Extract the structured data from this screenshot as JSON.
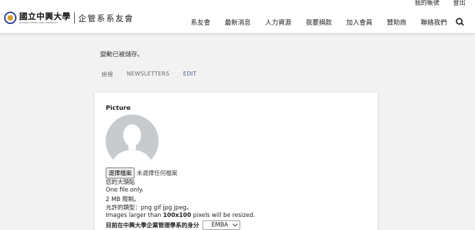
{
  "header": {
    "top_links": [
      "我的帳號",
      "登出"
    ],
    "logo": {
      "university": "國立中興大學",
      "university_en": "NATIONAL CHUNG HSING UNIVERSITY",
      "department": "企管系系友會"
    },
    "nav": [
      "系友會",
      "最新消息",
      "人力資源",
      "我要捐款",
      "加入會員",
      "贊助商",
      "聯絡我們"
    ],
    "search_icon": "search-icon"
  },
  "status_message": "變動已被儲存。",
  "tabs": [
    {
      "label": "檢視",
      "active": false
    },
    {
      "label": "NEWSLETTERS",
      "active": false
    },
    {
      "label": "EDIT",
      "active": true
    }
  ],
  "form": {
    "picture_label": "Picture",
    "file_button": "選擇檔案",
    "file_status": "未選擇任何檔案",
    "help_lines": [
      "您的大頭貼",
      "One file only.",
      "2 MB 限制。",
      "允許的類型：png gif jpg jpeg。"
    ],
    "resize_prefix": "Images larger than ",
    "resize_dim": "100x100",
    "resize_suffix": " pixels will be resized.",
    "identity_label": "目前在中興大學企業管理學系的身分",
    "identity_value": "EMBA"
  },
  "colors": {
    "accent": "#3d5a8c",
    "background": "#f2f2f2",
    "avatar_bg": "#c7cbce"
  }
}
